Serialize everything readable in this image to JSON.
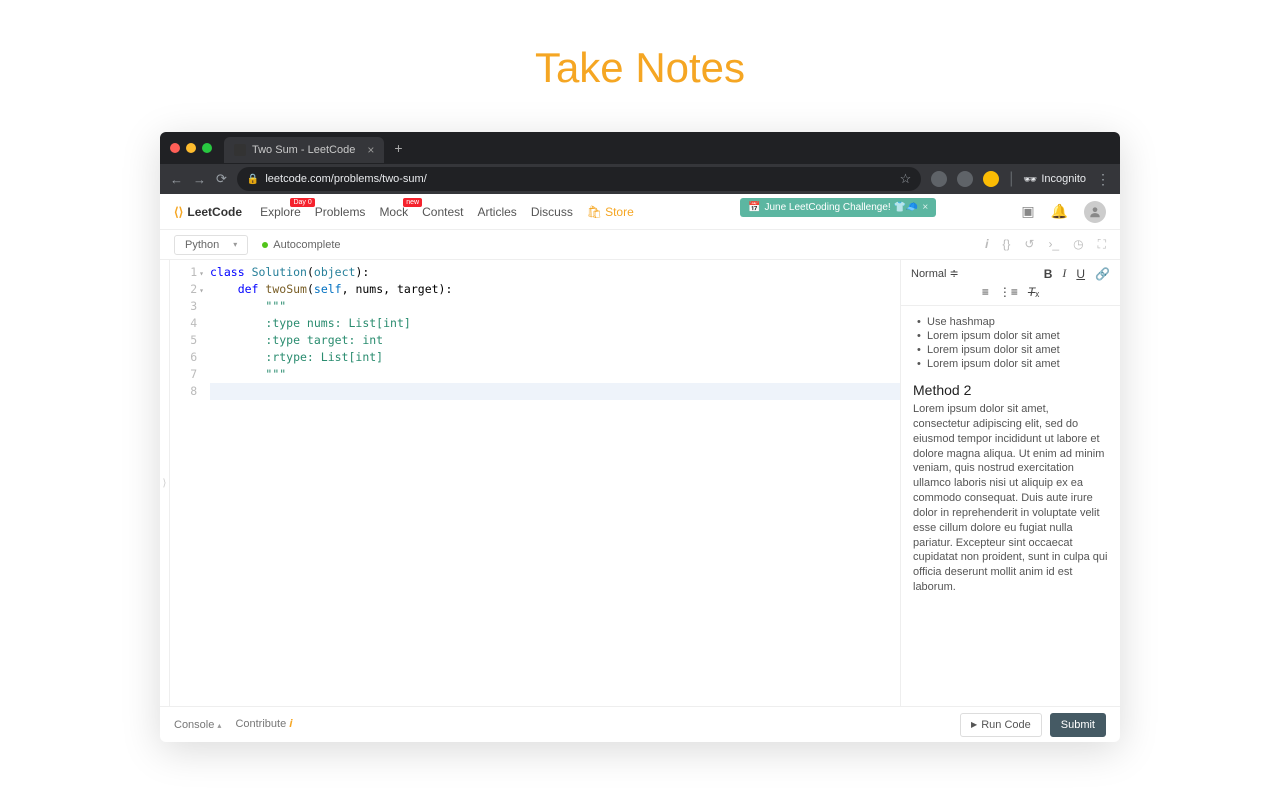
{
  "page_title": "Take Notes",
  "browser": {
    "tab_title": "Two Sum - LeetCode",
    "url": "leetcode.com/problems/two-sum/",
    "incognito_label": "Incognito"
  },
  "header": {
    "logo": "LeetCode",
    "nav": {
      "explore": "Explore",
      "explore_badge": "Day 0",
      "problems": "Problems",
      "mock": "Mock",
      "mock_badge": "new",
      "contest": "Contest",
      "articles": "Articles",
      "discuss": "Discuss",
      "store": "Store"
    },
    "banner": "June LeetCoding Challenge! 👕🧢"
  },
  "toolbar": {
    "language": "Python",
    "autocomplete": "Autocomplete"
  },
  "code": {
    "lines": [
      {
        "n": "1",
        "fold": "▾",
        "html": "<span class='kw'>class</span> <span class='cls'>Solution</span>(<span class='cls'>object</span>):"
      },
      {
        "n": "2",
        "fold": "▾",
        "html": "    <span class='kw'>def</span> <span class='fn'>twoSum</span>(<span class='self'>self</span>, nums, target):"
      },
      {
        "n": "3",
        "fold": "",
        "html": "        <span class='str'>\"\"\"</span>"
      },
      {
        "n": "4",
        "fold": "",
        "html": "        <span class='str'>:type nums: List[int]</span>"
      },
      {
        "n": "5",
        "fold": "",
        "html": "        <span class='str'>:type target: int</span>"
      },
      {
        "n": "6",
        "fold": "",
        "html": "        <span class='str'>:rtype: List[int]</span>"
      },
      {
        "n": "7",
        "fold": "",
        "html": "        <span class='str'>\"\"\"</span>"
      },
      {
        "n": "8",
        "fold": "",
        "html": "        ",
        "hl": true
      }
    ]
  },
  "notes": {
    "format_label": "Normal",
    "bullets": [
      "Use hashmap",
      "Lorem ipsum dolor sit amet",
      "Lorem ipsum dolor sit amet",
      "Lorem ipsum dolor sit amet"
    ],
    "heading": "Method 2",
    "paragraph": "Lorem ipsum dolor sit amet, consectetur adipiscing elit, sed do eiusmod tempor incididunt ut labore et dolore magna aliqua. Ut enim ad minim veniam, quis nostrud exercitation ullamco laboris nisi ut aliquip ex ea commodo consequat. Duis aute irure dolor in reprehenderit in voluptate velit esse cillum dolore eu fugiat nulla pariatur. Excepteur sint occaecat cupidatat non proident, sunt in culpa qui officia deserunt mollit anim id est laborum."
  },
  "footer": {
    "console": "Console",
    "contribute": "Contribute",
    "run": "Run Code",
    "submit": "Submit"
  }
}
